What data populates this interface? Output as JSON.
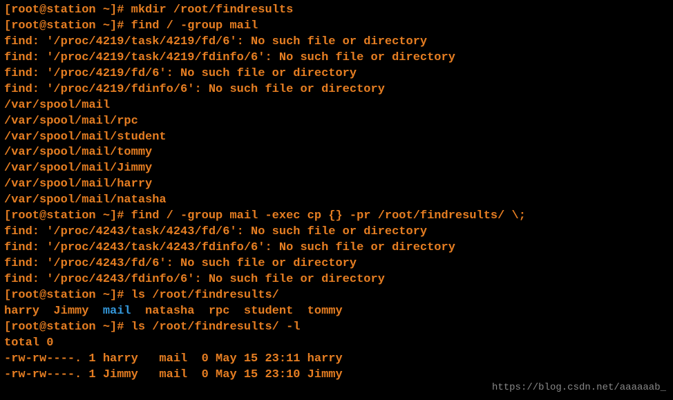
{
  "lines": [
    {
      "type": "cmd",
      "prompt": "[root@station ~]# ",
      "command": "mkdir /root/findresults"
    },
    {
      "type": "cmd",
      "prompt": "[root@station ~]# ",
      "command": "find / -group mail"
    },
    {
      "type": "out",
      "text": "find: '/proc/4219/task/4219/fd/6': No such file or directory"
    },
    {
      "type": "out",
      "text": "find: '/proc/4219/task/4219/fdinfo/6': No such file or directory"
    },
    {
      "type": "out",
      "text": "find: '/proc/4219/fd/6': No such file or directory"
    },
    {
      "type": "out",
      "text": "find: '/proc/4219/fdinfo/6': No such file or directory"
    },
    {
      "type": "out",
      "text": "/var/spool/mail"
    },
    {
      "type": "out",
      "text": "/var/spool/mail/rpc"
    },
    {
      "type": "out",
      "text": "/var/spool/mail/student"
    },
    {
      "type": "out",
      "text": "/var/spool/mail/tommy"
    },
    {
      "type": "out",
      "text": "/var/spool/mail/Jimmy"
    },
    {
      "type": "out",
      "text": "/var/spool/mail/harry"
    },
    {
      "type": "out",
      "text": "/var/spool/mail/natasha"
    },
    {
      "type": "cmd",
      "prompt": "[root@station ~]# ",
      "command": "find / -group mail -exec cp {} -pr /root/findresults/ \\;"
    },
    {
      "type": "out",
      "text": "find: '/proc/4243/task/4243/fd/6': No such file or directory"
    },
    {
      "type": "out",
      "text": "find: '/proc/4243/task/4243/fdinfo/6': No such file or directory"
    },
    {
      "type": "out",
      "text": "find: '/proc/4243/fd/6': No such file or directory"
    },
    {
      "type": "out",
      "text": "find: '/proc/4243/fdinfo/6': No such file or directory"
    },
    {
      "type": "cmd",
      "prompt": "[root@station ~]# ",
      "command": "ls /root/findresults/"
    },
    {
      "type": "ls",
      "parts": [
        {
          "text": "harry  Jimmy  ",
          "class": ""
        },
        {
          "text": "mail",
          "class": "blue"
        },
        {
          "text": "  natasha  rpc  student  tommy",
          "class": ""
        }
      ]
    },
    {
      "type": "cmd",
      "prompt": "[root@station ~]# ",
      "command": "ls /root/findresults/ -l"
    },
    {
      "type": "out",
      "text": "total 0"
    },
    {
      "type": "out",
      "text": "-rw-rw----. 1 harry   mail  0 May 15 23:11 harry"
    },
    {
      "type": "out",
      "text": "-rw-rw----. 1 Jimmy   mail  0 May 15 23:10 Jimmy"
    }
  ],
  "watermark": "https://blog.csdn.net/aaaaaab_"
}
